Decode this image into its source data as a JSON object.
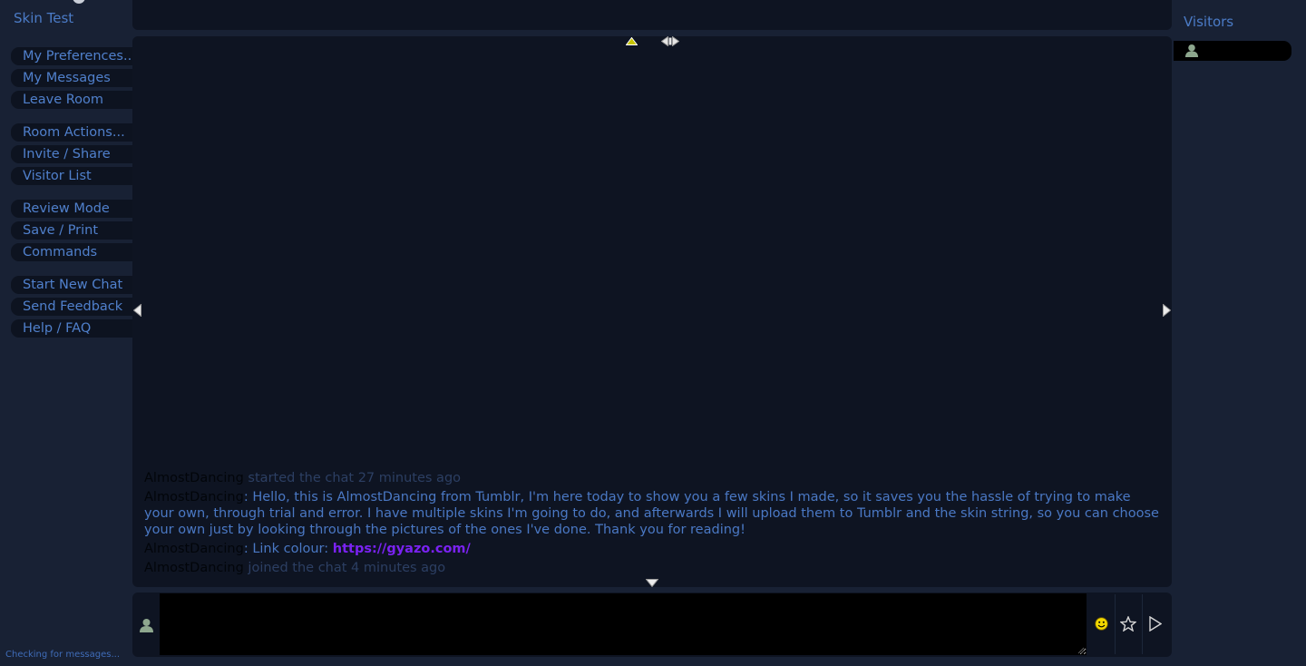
{
  "room": {
    "title": "Skin Test"
  },
  "sidebar": {
    "groups": [
      {
        "items": [
          {
            "label": "My Preferences..."
          },
          {
            "label": "My Messages"
          },
          {
            "label": "Leave Room"
          }
        ]
      },
      {
        "items": [
          {
            "label": "Room Actions..."
          },
          {
            "label": "Invite / Share"
          },
          {
            "label": "Visitor List"
          }
        ]
      },
      {
        "items": [
          {
            "label": "Review Mode"
          },
          {
            "label": "Save / Print"
          },
          {
            "label": "Commands"
          }
        ]
      },
      {
        "items": [
          {
            "label": "Start New Chat"
          },
          {
            "label": "Send Feedback"
          },
          {
            "label": "Help / FAQ"
          }
        ]
      }
    ],
    "status": "Checking for messages..."
  },
  "chat": {
    "messages": [
      {
        "author": "AlmostDancing",
        "system": " started the chat 27 minutes ago"
      },
      {
        "author": "AlmostDancing",
        "text": ": Hello, this is AlmostDancing from Tumblr, I'm here today to show you a few skins I made, so it saves you the hassle of trying to make your own, through trial and error. I have multiple skins I'm going to do, and afterwards I will upload them to Tumblr and the skin string, so you can choose your own just by looking through the pictures of the ones I've done. Thank you for reading!"
      },
      {
        "author": "AlmostDancing",
        "text": ": Link colour: ",
        "link": "https://gyazo.com/"
      },
      {
        "author": "AlmostDancing",
        "system": " joined the chat 4 minutes ago"
      }
    ]
  },
  "visitors": {
    "title": "Visitors",
    "list": [
      {
        "icon": "user-icon"
      }
    ]
  },
  "colors": {
    "background": "#182134",
    "panel": "#0e1422",
    "text": "#4a78c4",
    "link": "#7a22f2",
    "author": "#02050a",
    "system_text": "#2c3f63"
  },
  "icons": {
    "scroll_top": "triangle-up-icon",
    "expand_width": "double-arrow-icon",
    "scroll_left": "triangle-left-icon",
    "scroll_right": "triangle-right-icon",
    "scroll_bottom": "triangle-down-icon",
    "identity": "user-icon",
    "smiley": "smiley-icon",
    "favorite": "star-icon",
    "send": "send-icon"
  }
}
